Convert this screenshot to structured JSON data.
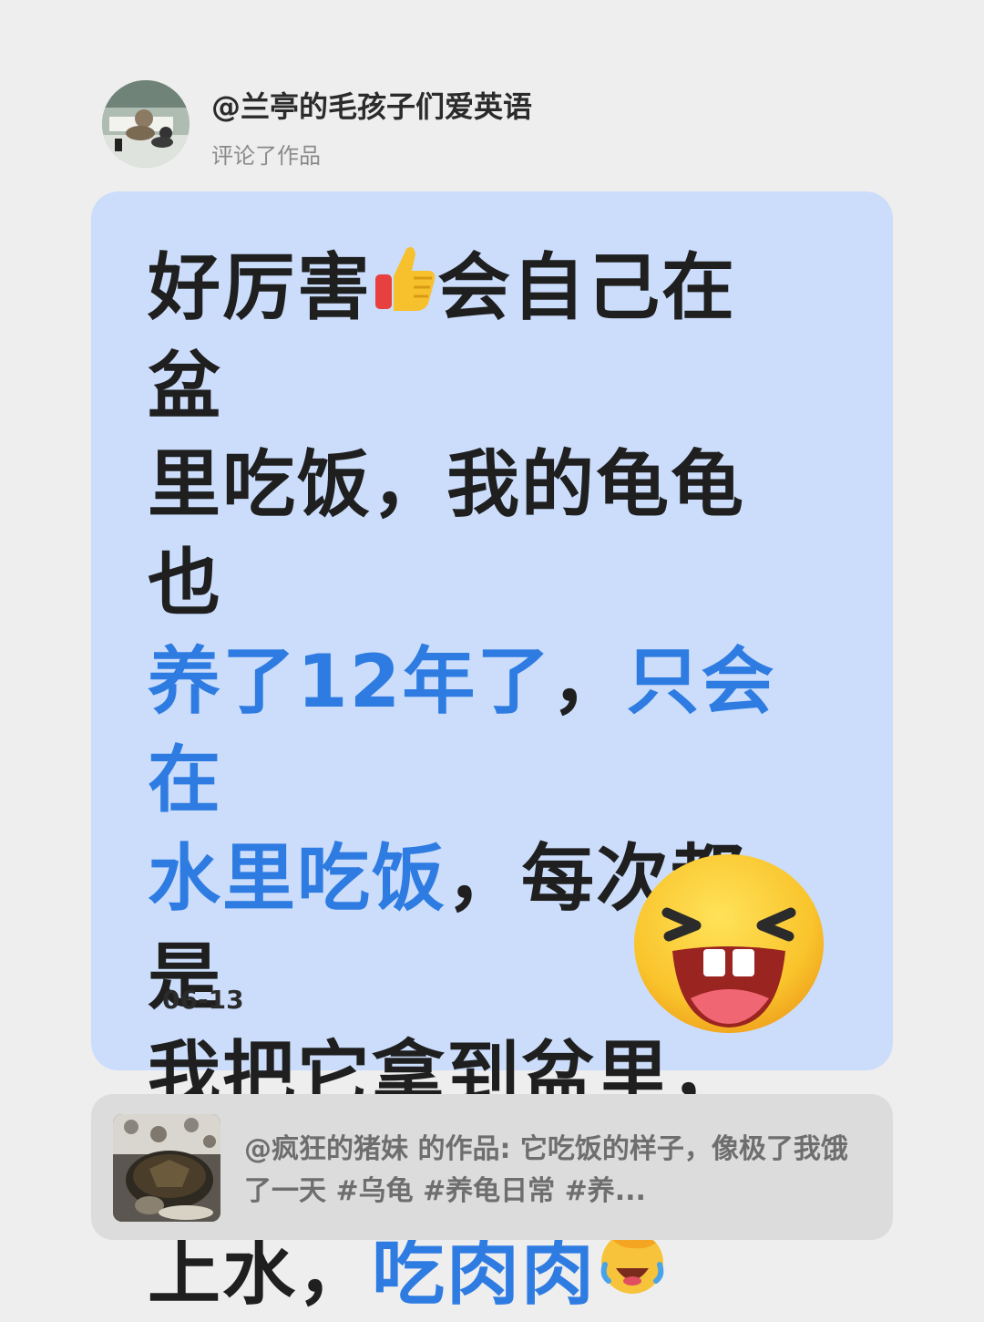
{
  "header": {
    "username": "@兰亭的毛孩子们爱英语",
    "action": "评论了作品",
    "avatar_icon": "cat-avatar"
  },
  "comment": {
    "line1_a": "好厉害",
    "line1_emoji": "thumbs-up-icon",
    "line1_b": "会自己在盆",
    "line2": "里吃饭，我的龟龟也",
    "line3_hl_a": "养了12年了",
    "line3_comma": "，",
    "line3_hl_b": "只会在",
    "line4_hl": "水里吃饭",
    "line4_rest": "，每次都是",
    "line5": "我把它拿到盆里，加",
    "line6_a": "上水，",
    "line6_hl": "吃肉肉",
    "line6_emoji": "facepalm-laugh-icon",
    "date": "06-13",
    "big_emoji": "laughing-face-icon"
  },
  "reference": {
    "text": "@疯狂的猪妹 的作品: 它吃饭的样子，像极了我饿了一天 #乌龟 #养龟日常 #养...",
    "thumb_icon": "turtle-thumbnail"
  },
  "colors": {
    "background": "#eeeeee",
    "card": "#cbddfb",
    "highlight": "#2e7ce2",
    "reference_card": "#dcdcdc"
  }
}
